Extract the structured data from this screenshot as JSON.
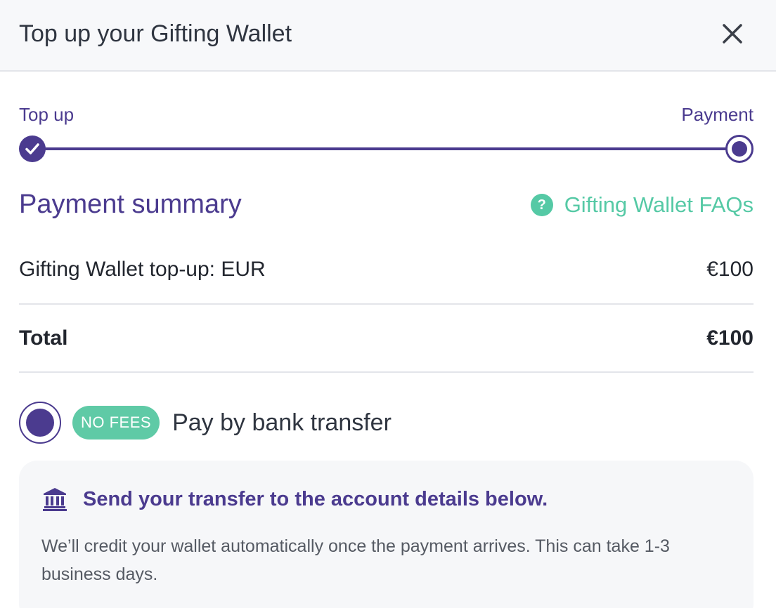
{
  "modal": {
    "title": "Top up your Gifting Wallet",
    "close_icon": "close-icon"
  },
  "stepper": {
    "steps": [
      {
        "label": "Top up",
        "state": "completed",
        "icon": "check-icon"
      },
      {
        "label": "Payment",
        "state": "current"
      }
    ]
  },
  "summary": {
    "title": "Payment summary",
    "faq_label": "Gifting Wallet FAQs",
    "faq_icon": "question-icon",
    "topup_label": "Gifting Wallet top-up: EUR",
    "topup_value": "€100",
    "total_label": "Total",
    "total_value": "€100"
  },
  "payment_option": {
    "selected": true,
    "badge": "NO FEES",
    "label": "Pay by bank transfer"
  },
  "info_box": {
    "icon": "bank-icon",
    "heading": "Send your transfer to the account details below.",
    "body": "We’ll credit your wallet automatically once the payment arrives. This can take 1-3 business days."
  },
  "colors": {
    "primary": "#4b3b8f",
    "accent": "#55c9a5",
    "text": "#22262e",
    "muted": "#555a63",
    "header_bg": "#f7f8fa",
    "box_bg": "#f6f7f9"
  }
}
